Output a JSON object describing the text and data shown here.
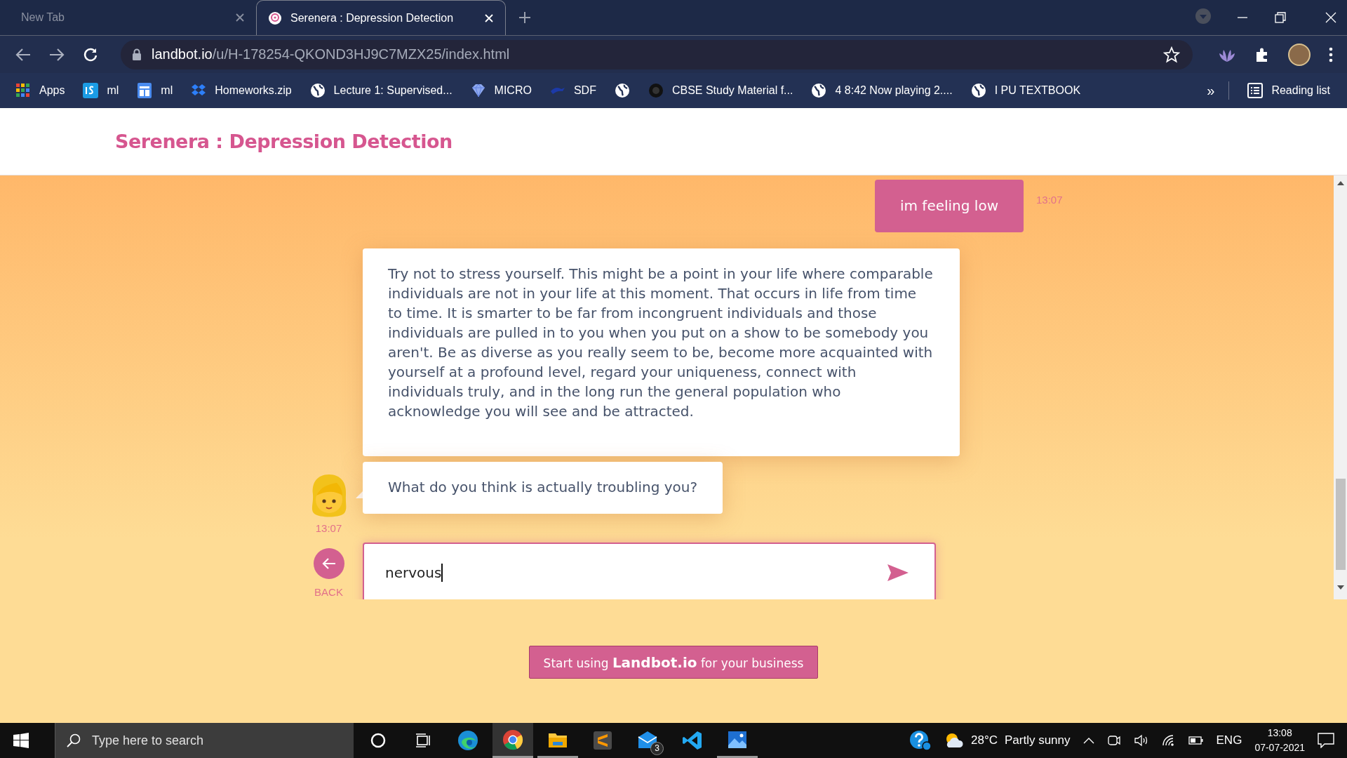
{
  "browser": {
    "tabs": [
      {
        "title": "New Tab",
        "selected": false
      },
      {
        "title": "Serenera : Depression Detection",
        "selected": true
      }
    ],
    "address": {
      "host": "landbot.io",
      "path": "/u/H-178254-QKOND3HJ9C7MZX25/index.html"
    },
    "bookmarks": [
      {
        "label": "Apps",
        "kind": "grid"
      },
      {
        "label": "ml",
        "kind": "tile"
      },
      {
        "label": "ml",
        "kind": "doc"
      },
      {
        "label": "Homeworks.zip",
        "kind": "box"
      },
      {
        "label": "Lecture 1: Supervised...",
        "kind": "globe"
      },
      {
        "label": "MICRO",
        "kind": "gem"
      },
      {
        "label": "SDF",
        "kind": "bird"
      },
      {
        "kind": "globe"
      },
      {
        "label": "CBSE Study Material f...",
        "kind": "dark"
      },
      {
        "label": "4 8:42 Now playing 2....",
        "kind": "globe"
      },
      {
        "label": "I PU TEXTBOOK",
        "kind": "globe"
      }
    ],
    "more": "»",
    "reading_list": "Reading list"
  },
  "page": {
    "title": "Serenera : Depression Detection",
    "messages": [
      {
        "kind": "user",
        "text": "im feeling low",
        "time": "13:07"
      },
      {
        "kind": "bot",
        "text": "Try not to stress yourself. This might be a point in your life where comparable individuals are not in your life at this moment. That occurs in life from time to time. It is smarter to be far from incongruent individuals and those individuals are pulled in to you when you put on a show to be somebody you aren't. Be as diverse as you really seem to be, become more acquainted with yourself at a profound level, regard your uniqueness, connect with individuals truly, and in the long run the general population who acknowledge you will see and be attracted."
      },
      {
        "kind": "bot",
        "text": "What do you think is actually troubling you?",
        "time": "13:07"
      }
    ],
    "reply": {
      "value": "nervous"
    },
    "back": "BACK",
    "promo": "Start using **Landbot.io** for your business"
  },
  "taskbar": {
    "search_placeholder": "Type here to search",
    "apps": [
      {
        "kind": "cortana",
        "selected": false,
        "running": false
      },
      {
        "kind": "taskview",
        "selected": false,
        "running": false
      },
      {
        "kind": "edge",
        "selected": false,
        "running": false
      },
      {
        "kind": "chrome",
        "selected": true,
        "running": true
      },
      {
        "kind": "files",
        "selected": false,
        "running": true
      },
      {
        "kind": "sublime",
        "selected": false,
        "running": false
      },
      {
        "kind": "mail",
        "selected": false,
        "running": false,
        "badge": "3"
      },
      {
        "kind": "vscode",
        "selected": false,
        "running": false
      },
      {
        "kind": "photos",
        "selected": false,
        "running": true
      }
    ],
    "weather": {
      "temp": "28°C",
      "text": "Partly sunny"
    },
    "language": "ENG",
    "time": "13:08",
    "date": "07-07-2021"
  }
}
